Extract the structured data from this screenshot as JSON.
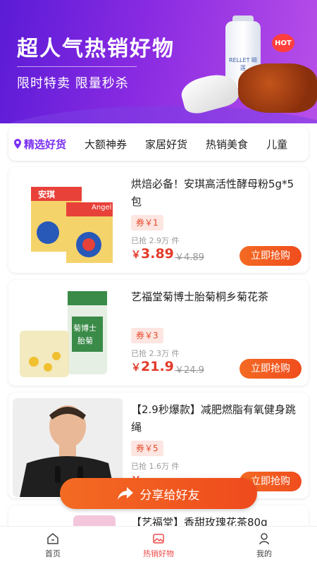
{
  "banner": {
    "title": "超人气热销好物",
    "subtitle": "限时特卖 限量秒杀",
    "bottle_label": "RELLET 颐莲",
    "hot_badge": "HOT"
  },
  "tabs": [
    {
      "label": "精选好货",
      "active": true
    },
    {
      "label": "大额神券",
      "active": false
    },
    {
      "label": "家居好货",
      "active": false
    },
    {
      "label": "热销美食",
      "active": false
    },
    {
      "label": "儿童",
      "active": false
    }
  ],
  "products": [
    {
      "title": "烘焙必备！安琪高活性酵母粉5g*5包",
      "coupon": "券￥1",
      "sold": "已抢 2.9万 件",
      "price_sign": "￥",
      "price": "3.89",
      "orig_price": "￥4.89",
      "buy_label": "立即抢购",
      "thumb_text_1": "安琪",
      "thumb_text_2": "Angel"
    },
    {
      "title": "艺福堂菊博士胎菊桐乡菊花茶",
      "coupon": "券￥3",
      "sold": "已抢 2.3万 件",
      "price_sign": "￥",
      "price": "21.9",
      "orig_price": "￥24.9",
      "buy_label": "立即抢购",
      "thumb_text_1": "菊博士",
      "thumb_text_2": "胎菊"
    },
    {
      "title": "【2.9秒爆款】减肥燃脂有氧健身跳绳",
      "coupon": "券￥5",
      "sold": "已抢 1.6万 件",
      "price_sign": "￥",
      "price": "",
      "orig_price": "",
      "buy_label": "立即抢购"
    },
    {
      "title": "【艺福堂】香甜玫瑰花茶80g"
    }
  ],
  "share_label": "分享给好友",
  "nav": [
    {
      "label": "首页",
      "active": false
    },
    {
      "label": "热销好物",
      "active": true
    },
    {
      "label": "我的",
      "active": false
    }
  ],
  "colors": {
    "accent_purple": "#7b2ff2",
    "price_red": "#e33b2a",
    "button_orange": "#f04d1e",
    "nav_active": "#ef4a4a"
  }
}
